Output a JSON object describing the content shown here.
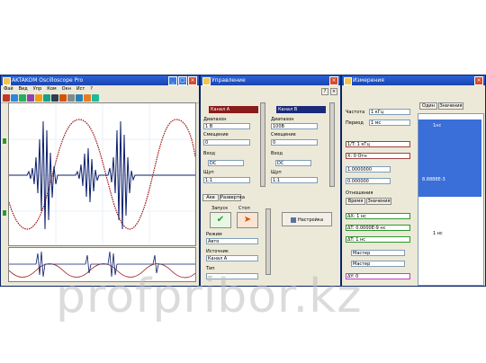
{
  "scope_window": {
    "title": "AKTAKOM Oscilloscope Pro",
    "menu": [
      "Фай",
      "Вид",
      "Упр",
      "Ком",
      "Окн",
      "Ист",
      "?"
    ]
  },
  "control_window": {
    "title": "Управление",
    "channel_a": "Канал A",
    "channel_b": "Канал B",
    "labels": [
      "Диапазон",
      "Смещение",
      "Вход",
      "Щуп"
    ],
    "values_a": [
      "1 В",
      "0",
      "DC",
      "1:1"
    ],
    "values_b": [
      "100В",
      "0",
      "DC",
      "1:1"
    ],
    "tabs": [
      "Акв",
      "Развертка"
    ],
    "buttons": [
      "Запуск",
      "Стоп"
    ],
    "bottom_labels": [
      "Режим",
      "Источник",
      "Тип"
    ],
    "bottom_values": [
      "Авто",
      "Канал A",
      "—"
    ],
    "action_button": "Настройка"
  },
  "measure_window": {
    "title": "Измерения",
    "tabs": [
      "Один",
      "Значения"
    ],
    "fields": [
      "Частота",
      "Период"
    ],
    "field_values": [
      "1 кГц",
      "1 мс"
    ],
    "markers": [
      "1/T: 1 кГц",
      "X: 0 Отн",
      "1.0000000",
      "0.000000"
    ],
    "group": "Отношения",
    "group_tabs": [
      "Время",
      "Значения"
    ],
    "readouts": [
      "ΔX: 1 нс",
      "ΔT: 0.0000Е-9 нс",
      "ΔT: 1 нс"
    ],
    "selects": [
      "Мастер",
      "Мастер"
    ],
    "last_readout": "ΔY: 0",
    "list_items": [
      "1нс",
      "8.8888E-3",
      "1 нс"
    ]
  },
  "watermark": "profpribor.kz",
  "colors": {
    "title_blue": "#1c44b0",
    "window_bg": "#ece9d8",
    "channel_a_header": "#8b1a1a",
    "channel_b_header": "#1a2a7a",
    "plot_bg": "#ffffff"
  }
}
